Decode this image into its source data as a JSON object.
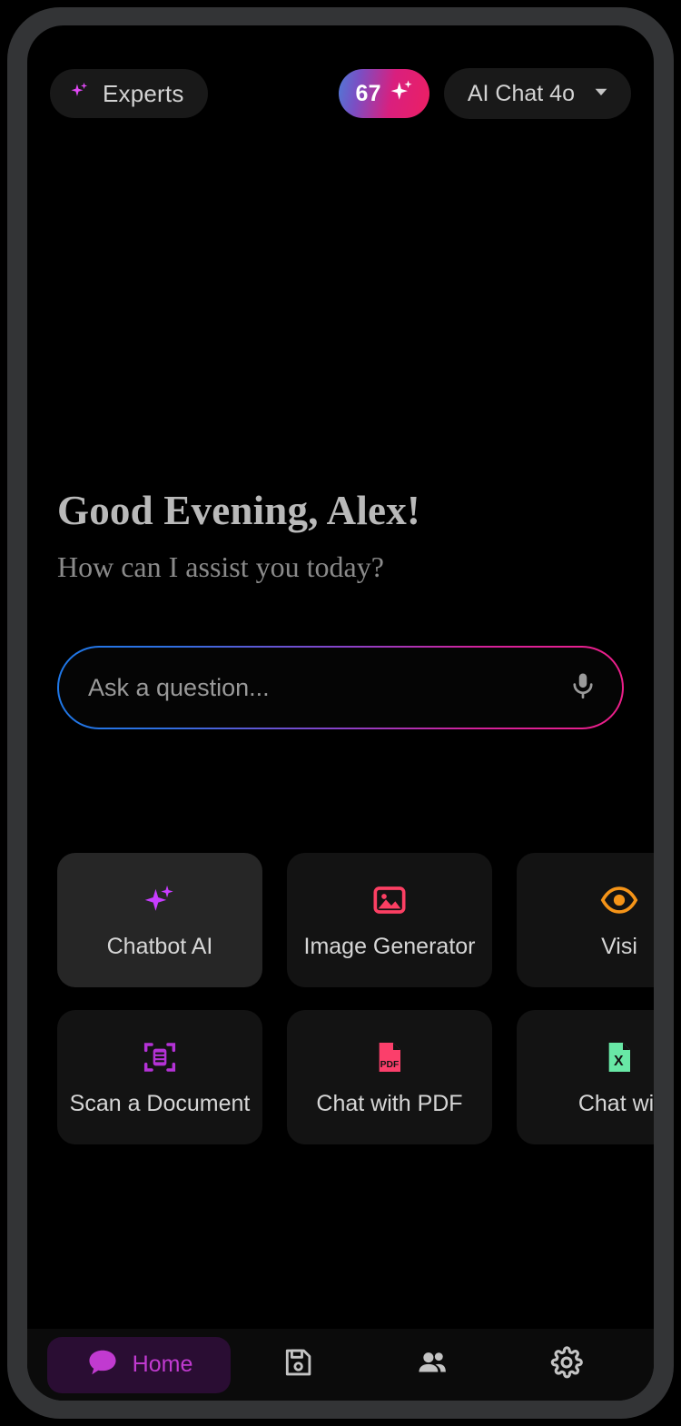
{
  "top_bar": {
    "experts_label": "Experts",
    "experts_icon": "sparkle-icon",
    "credits_count": "67",
    "credits_icon": "sparkle-icon",
    "model_label": "AI Chat 4o",
    "model_chevron_icon": "chevron-down-icon"
  },
  "greeting": {
    "title": "Good Evening, Alex!",
    "subtitle": "How can I assist you today?"
  },
  "search": {
    "placeholder": "Ask a question...",
    "value": "",
    "mic_icon": "microphone-icon"
  },
  "features": {
    "row1": [
      {
        "label": "Chatbot AI",
        "icon": "sparkle-icon",
        "color": "#c83dff",
        "highlighted": true
      },
      {
        "label": "Image Generator",
        "icon": "image-icon",
        "color": "#fc3f63",
        "highlighted": false
      },
      {
        "label": "Visi",
        "icon": "eye-icon",
        "color": "#f59418",
        "highlighted": false
      }
    ],
    "row2": [
      {
        "label": "Scan a Document",
        "icon": "scan-document-icon",
        "color": "#b432d6",
        "highlighted": false
      },
      {
        "label": "Chat with PDF",
        "icon": "pdf-file-icon",
        "color": "#fb3f6b",
        "highlighted": false
      },
      {
        "label": "Chat wit",
        "icon": "excel-file-icon",
        "color": "#68e8a6",
        "highlighted": false
      }
    ]
  },
  "bottom_nav": {
    "items": [
      {
        "label": "Home",
        "icon": "chat-bubble-icon",
        "active": true
      },
      {
        "label": "",
        "icon": "save-disk-icon",
        "active": false
      },
      {
        "label": "",
        "icon": "users-icon",
        "active": false
      },
      {
        "label": "",
        "icon": "gear-icon",
        "active": false
      }
    ]
  },
  "colors": {
    "accent_purple": "#c13ad0",
    "gradient_start": "#1e78e8",
    "gradient_end": "#ee1f8a"
  }
}
